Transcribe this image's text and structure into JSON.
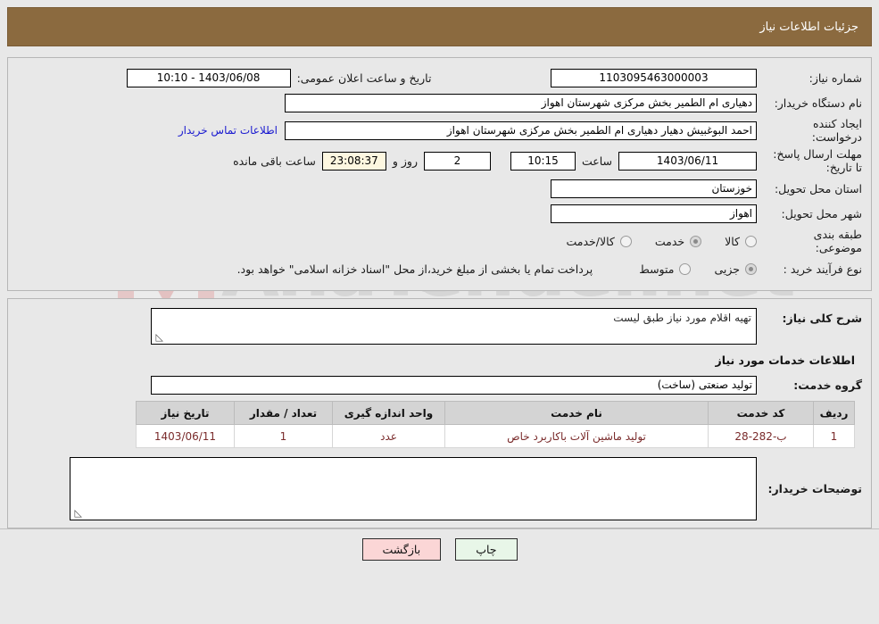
{
  "header": {
    "title": "جزئیات اطلاعات نیاز"
  },
  "form": {
    "need_number_label": "شماره نیاز:",
    "need_number_value": "1103095463000003",
    "announce_datetime_label": "تاریخ و ساعت اعلان عمومی:",
    "announce_datetime_value": "1403/06/08 - 10:10",
    "buyer_org_label": "نام دستگاه خریدار:",
    "buyer_org_value": "دهیاری ام الطمیر بخش مرکزی شهرستان اهواز",
    "requester_label": "ایجاد کننده درخواست:",
    "requester_value": "احمد البوغبیش دهیار دهیاری ام الطمیر بخش مرکزی شهرستان اهواز",
    "contact_link": "اطلاعات تماس خریدار",
    "deadline_label": "مهلت ارسال پاسخ: تا تاریخ:",
    "deadline_date": "1403/06/11",
    "hour_label": "ساعت",
    "deadline_time": "10:15",
    "days_value": "2",
    "days_label": "روز و",
    "countdown_value": "23:08:37",
    "remaining_label": "ساعت باقی مانده",
    "province_label": "استان محل تحویل:",
    "province_value": "خوزستان",
    "city_label": "شهر محل تحویل:",
    "city_value": "اهواز",
    "category_label": "طبقه بندی موضوعی:",
    "category_options": [
      {
        "label": "کالا",
        "selected": false
      },
      {
        "label": "خدمت",
        "selected": true
      },
      {
        "label": "کالا/خدمت",
        "selected": false
      }
    ],
    "purchase_type_label": "نوع فرآیند خرید :",
    "purchase_type_options": [
      {
        "label": "جزیی",
        "selected": true
      },
      {
        "label": "متوسط",
        "selected": false
      }
    ],
    "payment_note": "پرداخت تمام یا بخشی از مبلغ خرید،از محل \"اسناد خزانه اسلامی\" خواهد بود."
  },
  "details": {
    "general_desc_label": "شرح کلی نیاز:",
    "general_desc_value": "تهیه اقلام مورد نیاز طبق لیست",
    "services_section_title": "اطلاعات خدمات مورد نیاز",
    "service_group_label": "گروه خدمت:",
    "service_group_value": "تولید صنعتی (ساخت)",
    "buyer_notes_label": "توضیحات خریدار:",
    "buyer_notes_value": ""
  },
  "table": {
    "headers": [
      "ردیف",
      "کد خدمت",
      "نام خدمت",
      "واحد اندازه گیری",
      "تعداد / مقدار",
      "تاریخ نیاز"
    ],
    "rows": [
      {
        "row": "1",
        "code": "ب-282-28",
        "name": "تولید ماشین آلات باکاربرد خاص",
        "unit": "عدد",
        "qty": "1",
        "date": "1403/06/11"
      }
    ]
  },
  "footer": {
    "print_label": "چاپ",
    "back_label": "بازگشت"
  },
  "watermark": {
    "text": "AnaTender.net"
  },
  "colors": {
    "header_bg": "#8b6a3f",
    "link": "#1a1ad0",
    "print_btn": "#e8f6e8",
    "back_btn": "#fbd6d6",
    "countdown_bg": "#fdf7e0"
  }
}
